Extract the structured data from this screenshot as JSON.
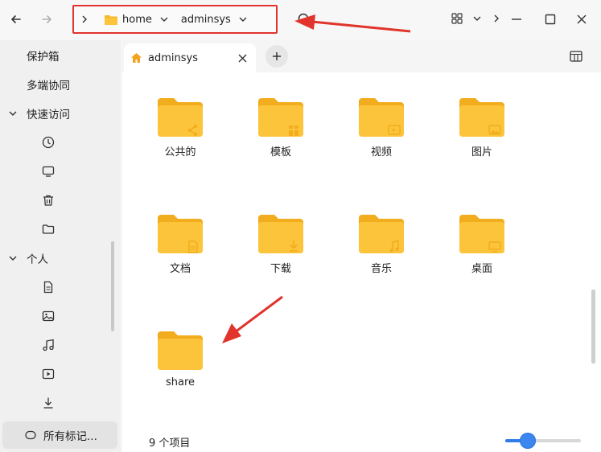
{
  "breadcrumb": {
    "items": [
      {
        "label": "home"
      },
      {
        "label": "adminsys"
      }
    ]
  },
  "sidebar": {
    "vault": "保护箱",
    "multidevice": "多端协同",
    "quick_access": "快速访问",
    "personal": "个人",
    "tags": "所有标记..."
  },
  "tab": {
    "label": "adminsys"
  },
  "folders": [
    {
      "label": "公共的",
      "emblem": "share-icon"
    },
    {
      "label": "模板",
      "emblem": "template-icon"
    },
    {
      "label": "视频",
      "emblem": "video-icon"
    },
    {
      "label": "图片",
      "emblem": "image-icon"
    },
    {
      "label": "文档",
      "emblem": "document-icon"
    },
    {
      "label": "下载",
      "emblem": "download-icon"
    },
    {
      "label": "音乐",
      "emblem": "music-icon"
    },
    {
      "label": "桌面",
      "emblem": "desktop-icon"
    },
    {
      "label": "share",
      "emblem": "none"
    }
  ],
  "status": {
    "count": "9 个项目"
  },
  "zoom": {
    "level": 0.3
  },
  "colors": {
    "folder": "#fcc43a",
    "folder_dark": "#f2ad1e",
    "accent": "#3b86ef",
    "annotation": "#e0342c"
  }
}
